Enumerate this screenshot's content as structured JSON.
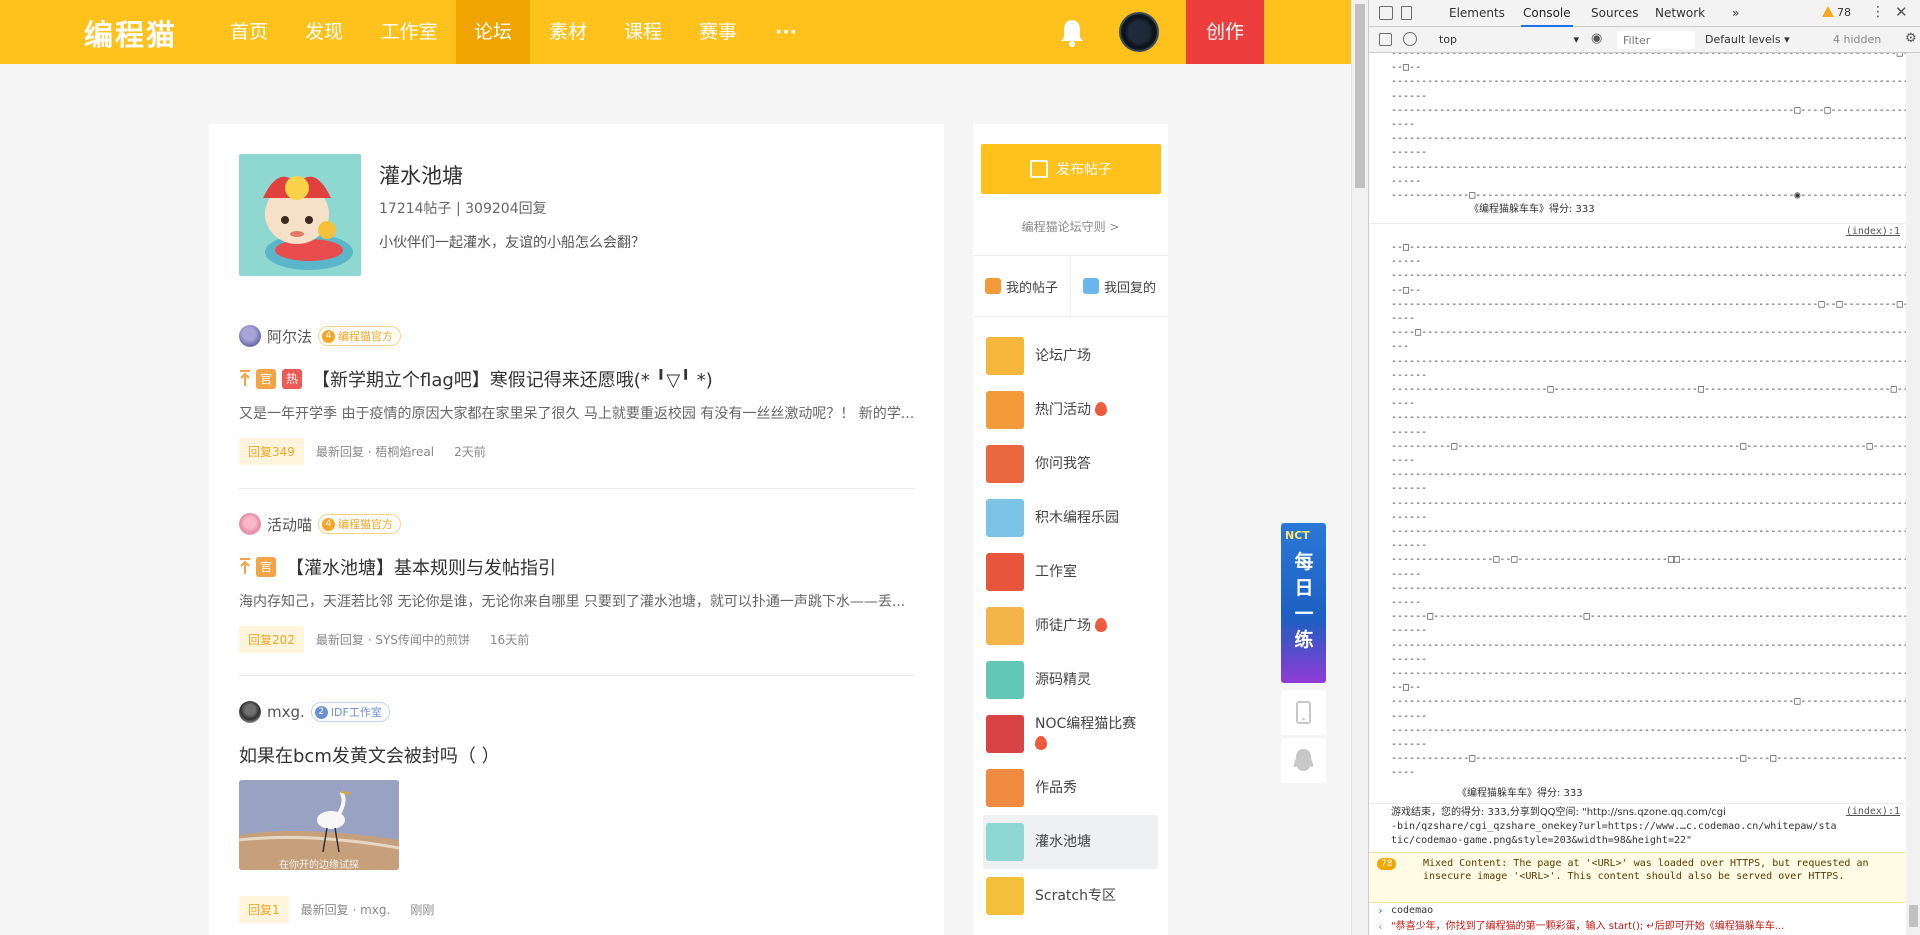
{
  "site": {
    "logo": "编程猫",
    "nav": [
      {
        "label": "首页",
        "active": false
      },
      {
        "label": "发现",
        "active": false
      },
      {
        "label": "工作室",
        "active": false
      },
      {
        "label": "论坛",
        "active": true
      },
      {
        "label": "素材",
        "active": false
      },
      {
        "label": "课程",
        "active": false
      },
      {
        "label": "赛事",
        "active": false
      },
      {
        "label": "···",
        "active": false
      }
    ],
    "create_label": "创作",
    "accent": "#ffc11b",
    "create_color": "#ee3d3d"
  },
  "board": {
    "title": "灌水池塘",
    "stats": "17214帖子 | 309204回复",
    "description": "小伙伴们一起灌水，友谊的小船怎么会翻？"
  },
  "posts": [
    {
      "author": "阿尔法",
      "badge": "编程猫官方",
      "badge_icon": "4",
      "tags": [
        "官",
        "热"
      ],
      "title": "【新学期立个flag吧】寒假记得来还愿哦(* ╹▽╹ *)",
      "excerpt": "又是一年开学季 由于疫情的原因大家都在家里呆了很久 马上就要重返校园 有没有一丝丝激动呢？！ 新的学...",
      "replies": "回复349",
      "latest": "最新回复 · 梧桐焰real",
      "time": "2天前"
    },
    {
      "author": "活动喵",
      "badge": "编程猫官方",
      "badge_icon": "4",
      "tags": [
        "官"
      ],
      "title": "【灌水池塘】基本规则与发帖指引",
      "excerpt": "海内存知己，天涯若比邻 无论你是谁，无论你来自哪里 只要到了灌水池塘，就可以扑通一声跳下水——丢...",
      "replies": "回复202",
      "latest": "最新回复 · SYS传闻中的煎饼",
      "time": "16天前"
    },
    {
      "author": "mxg.",
      "badge": "IDF工作室",
      "badge_icon": "2",
      "tags": [],
      "title": "如果在bcm发黄文会被封吗（ ）",
      "image_caption": "在你开的边缘试探",
      "replies": "回复1",
      "latest": "最新回复 · mxg.",
      "time": "刚刚"
    }
  ],
  "sidebar": {
    "publish_label": "发布帖子",
    "rules_link": "编程猫论坛守则 >",
    "my_posts": "我的帖子",
    "my_replies": "我回复的",
    "categories": [
      {
        "label": "论坛广场",
        "hot": false,
        "active": false,
        "color": "#f6b73c"
      },
      {
        "label": "热门活动",
        "hot": true,
        "active": false,
        "color": "#f39a3a"
      },
      {
        "label": "你问我答",
        "hot": false,
        "active": false,
        "color": "#e9663f"
      },
      {
        "label": "积木编程乐园",
        "hot": false,
        "active": false,
        "color": "#7cc3e8"
      },
      {
        "label": "工作室",
        "hot": false,
        "active": false,
        "color": "#e8553c"
      },
      {
        "label": "师徒广场",
        "hot": true,
        "active": false,
        "color": "#f3b54a"
      },
      {
        "label": "源码精灵",
        "hot": false,
        "active": false,
        "color": "#63c7b5"
      },
      {
        "label": "NOC编程猫比赛",
        "hot": true,
        "active": false,
        "color": "#d94343"
      },
      {
        "label": "作品秀",
        "hot": false,
        "active": false,
        "color": "#f08a3e"
      },
      {
        "label": "灌水池塘",
        "hot": false,
        "active": true,
        "color": "#8ed7d3"
      },
      {
        "label": "Scratch专区",
        "hot": false,
        "active": false,
        "color": "#f3c13c"
      }
    ]
  },
  "float_ad": {
    "brand": "NCT",
    "text": "每日一练"
  },
  "devtools": {
    "tabs": [
      "Elements",
      "Console",
      "Sources",
      "Network",
      "»"
    ],
    "active_tab": "Console",
    "warn_count": "78",
    "context": "top",
    "filter_placeholder": "Filter",
    "levels": "Default levels ▾",
    "hidden": "4 hidden",
    "block1": [
      "------------------------------------------------------------------------------------□----------------------------------------------------------",
      "--□--",
      "-----------------------------------------------------------------------------------------------------------------------------------------------",
      "------",
      "-------------------------------------------------------------------□----□---------------------------------------------------□---------------",
      "----",
      "-----------------------------------------------------------------------------------------------------------------------------------------------",
      "------",
      "-------------------------------------------------------------------------------------------------------□-------------------------------------",
      "-----",
      "-------------□-----------------------------------------------------◉-------------------------------------------------------------------------"
    ],
    "score_line_1": "《编程猫躲车车》得分: 333",
    "source_link": "(index):1",
    "block2": [
      "--□-------------------------------------------------------------------------------------------------------------------------------------------",
      "-----",
      "-----------------------------------------------------------------------------------------------------------------------------------------------",
      "--□--",
      "-----------------------------------------------------------------------□--□---------□-------------------------------------------------□-------",
      "----",
      "----□-----------------------------------------------------------------------------------------------------------□--------------------------□--",
      "---",
      "-----------------------------------------------------------------------------------------------------------------------------------------------",
      "------",
      "--------------------------□------------------------□-------------------------------□--------------------□---",
      "----",
      "-----------------------------------------------------------------------------------------------------------------------------------------------",
      "------",
      "----------□-----------------------------------------------□--------------------□-------------------------------",
      "----",
      "-----------------------------------------------------------------------------------------------------------------------------------------------",
      "------",
      "----------------------------------------------------------------------------------------------------□---------------------------------------",
      "------",
      "-----------------------------------------------------------------------------------------------------------------------------------------------",
      "------",
      "-----------------□--□-------------------------□□---------------------------------------------------------------------------------------------",
      "-----",
      "-----------------------------------------------------------------------------------------------------□------------------------------□---------",
      "-----",
      "------□-------------------------□----------------------------------------------------------------------------------------------------------",
      "------",
      "-----------------------------------------------------------------------------------------------------------------------------------------------",
      "------",
      "-----------------------------------------------------------------------------------------------------------------------------------------------",
      "--□--",
      "-------------------------------------------------------------------□--------------------------------------------------------------------------",
      "------",
      "-----------------------------------------------------------------------------------------------------------------------------------------------",
      "------",
      "-------------□--------------------------------------------□----□-------------------------------□-----------------",
      "----"
    ],
    "score_line_2": "《编程猫躲车车》得分: 333",
    "result_line_1": "游戏结束，您的得分: 333,分享到QQ空间: \"http://sns.qzone.qq.com/cgi",
    "result_line_2": "-bin/qzshare/cgi_qzshare_onekey?url=https://www.…c.codemao.cn/whitepaw/sta",
    "result_line_3": "tic/codemao-game.png&style=203&width=98&height=22\"",
    "result_link": "(index):1",
    "warning_count": "78",
    "warning_text": "Mixed Content: The page at '<URL>' was loaded over HTTPS, but requested an insecure image '<URL>'. This content should also be served over HTTPS.",
    "input_cmd": "codemao",
    "output_text": "\"恭喜少年，你找到了编程猫的第一颗彩蛋，输入 start(); ↵后即可开始《编程猫躲车车..."
  }
}
